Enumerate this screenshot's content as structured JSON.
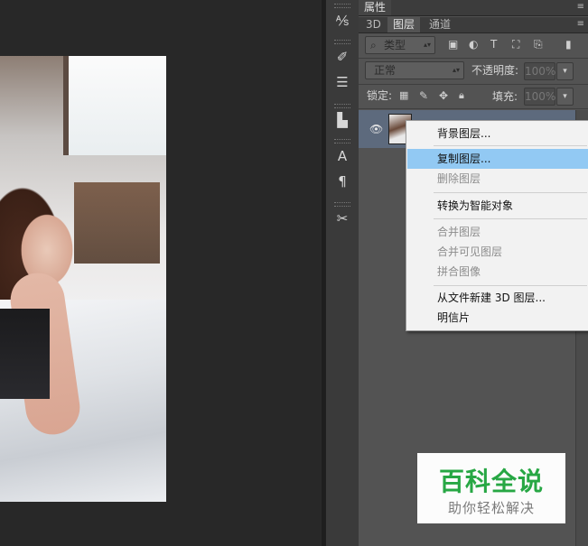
{
  "panel": {
    "properties_tab": "属性",
    "tabs": [
      "3D",
      "图层",
      "通道"
    ],
    "active_tab_index": 1,
    "filter_kind": "类型",
    "blend_mode": "正常",
    "opacity_label": "不透明度:",
    "opacity_value": "100%",
    "lock_label": "锁定:",
    "fill_label": "填充:",
    "fill_value": "100%",
    "menu_icon": "≡"
  },
  "tool_strip": {
    "icons": [
      "history-icon",
      "actions-icon",
      "adjustments-icon",
      "clone-source-icon",
      "character-icon",
      "paragraph-icon",
      "tool-presets-icon"
    ]
  },
  "context_menu": {
    "items": [
      {
        "label": "背景图层...",
        "disabled": false,
        "highlighted": false
      },
      {
        "label": "复制图层...",
        "disabled": false,
        "highlighted": true
      },
      {
        "label": "删除图层",
        "disabled": true,
        "highlighted": false
      },
      {
        "label": "转换为智能对象",
        "disabled": false,
        "highlighted": false
      },
      {
        "label": "合并图层",
        "disabled": true,
        "highlighted": false
      },
      {
        "label": "合并可见图层",
        "disabled": true,
        "highlighted": false
      },
      {
        "label": "拼合图像",
        "disabled": true,
        "highlighted": false
      },
      {
        "label": "从文件新建 3D 图层...",
        "disabled": false,
        "highlighted": false
      },
      {
        "label": "明信片",
        "disabled": false,
        "highlighted": false
      }
    ]
  },
  "watermark": {
    "title": "百科全说",
    "subtitle": "助你轻松解决"
  },
  "colors": {
    "highlight": "#92c9f3",
    "panel_bg": "#535353",
    "watermark_green": "#27a744"
  }
}
